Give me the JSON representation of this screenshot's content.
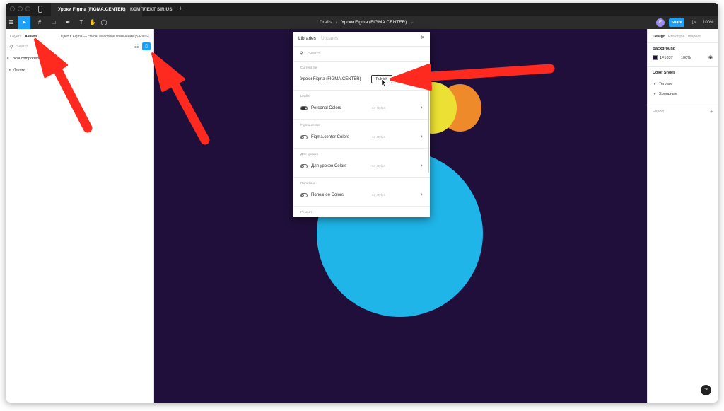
{
  "tabs": [
    {
      "label": "Уроки Figma (FIGMA.CENTER)",
      "active": true
    },
    {
      "label": "КОМПЛЕКТ SIRIUS",
      "active": false
    }
  ],
  "new_tab_icon": "+",
  "toolbar": {
    "breadcrumb_root": "Drafts",
    "breadcrumb_sep": "/",
    "file_name": "Уроки Figma (FIGMA.CENTER)",
    "share_label": "Share",
    "zoom": "100%",
    "avatar_initial": "E"
  },
  "left_panel": {
    "tab_layers": "Layers",
    "tab_assets": "Assets",
    "library_title": "Цвет в Figma — стили, массовое изменение (SIRIUS)",
    "search_placeholder": "Search",
    "local_components": "Local components",
    "item_icons": "Иконки"
  },
  "right_panel": {
    "tab_design": "Design",
    "tab_prototype": "Prototype",
    "tab_inspect": "Inspect",
    "background_label": "Background",
    "bg_hex": "1F1037",
    "bg_opacity": "100%",
    "color_styles_label": "Color Styles",
    "style_warm": "Теплые",
    "style_cold": "Холодные",
    "export_label": "Export",
    "export_add": "+"
  },
  "modal": {
    "tab_libraries": "Libraries",
    "tab_updates": "Updates",
    "close": "×",
    "search_placeholder": "Search",
    "current_file_header": "Current file",
    "current_file_name": "Уроки Figma (FIGMA.CENTER)",
    "publish_label": "Publish",
    "sections": [
      {
        "header": "Drafts",
        "name": "Personal Colors",
        "count": "17 styles",
        "enabled": true
      },
      {
        "header": "Figma.center",
        "name": "Figma.center Colors",
        "count": "17 styles",
        "enabled": false
      },
      {
        "header": "Для уроков",
        "name": "Для уроков Colors",
        "count": "17 styles",
        "enabled": false
      },
      {
        "header": "Полезное",
        "name": "Полезное Colors",
        "count": "17 styles",
        "enabled": false
      }
    ],
    "last_header": "Ремонт"
  },
  "help_label": "?",
  "colors": {
    "canvas": "#1f0f3a",
    "accent": "#18a0fb",
    "circle_blue": "#1fb5e8",
    "circle_yellow": "#ebe033",
    "circle_orange": "#ee8a2a",
    "arrow_red": "#ff2a1f"
  }
}
